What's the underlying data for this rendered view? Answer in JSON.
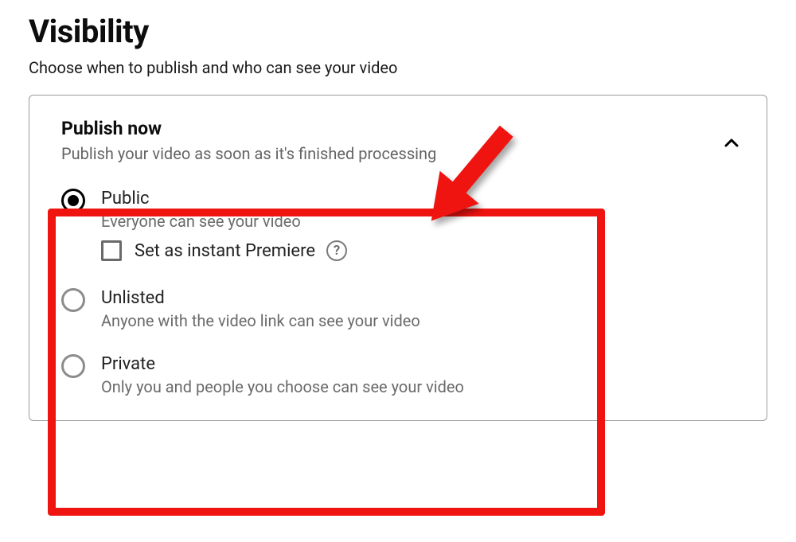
{
  "page": {
    "title": "Visibility",
    "subtitle": "Choose when to publish and who can see your video"
  },
  "section": {
    "title": "Publish now",
    "desc": "Publish your video as soon as it's finished processing"
  },
  "options": {
    "public": {
      "label": "Public",
      "desc": "Everyone can see your video",
      "premiere_label": "Set as instant Premiere"
    },
    "unlisted": {
      "label": "Unlisted",
      "desc": "Anyone with the video link can see your video"
    },
    "private": {
      "label": "Private",
      "desc": "Only you and people you choose can see your video"
    }
  },
  "help_glyph": "?"
}
